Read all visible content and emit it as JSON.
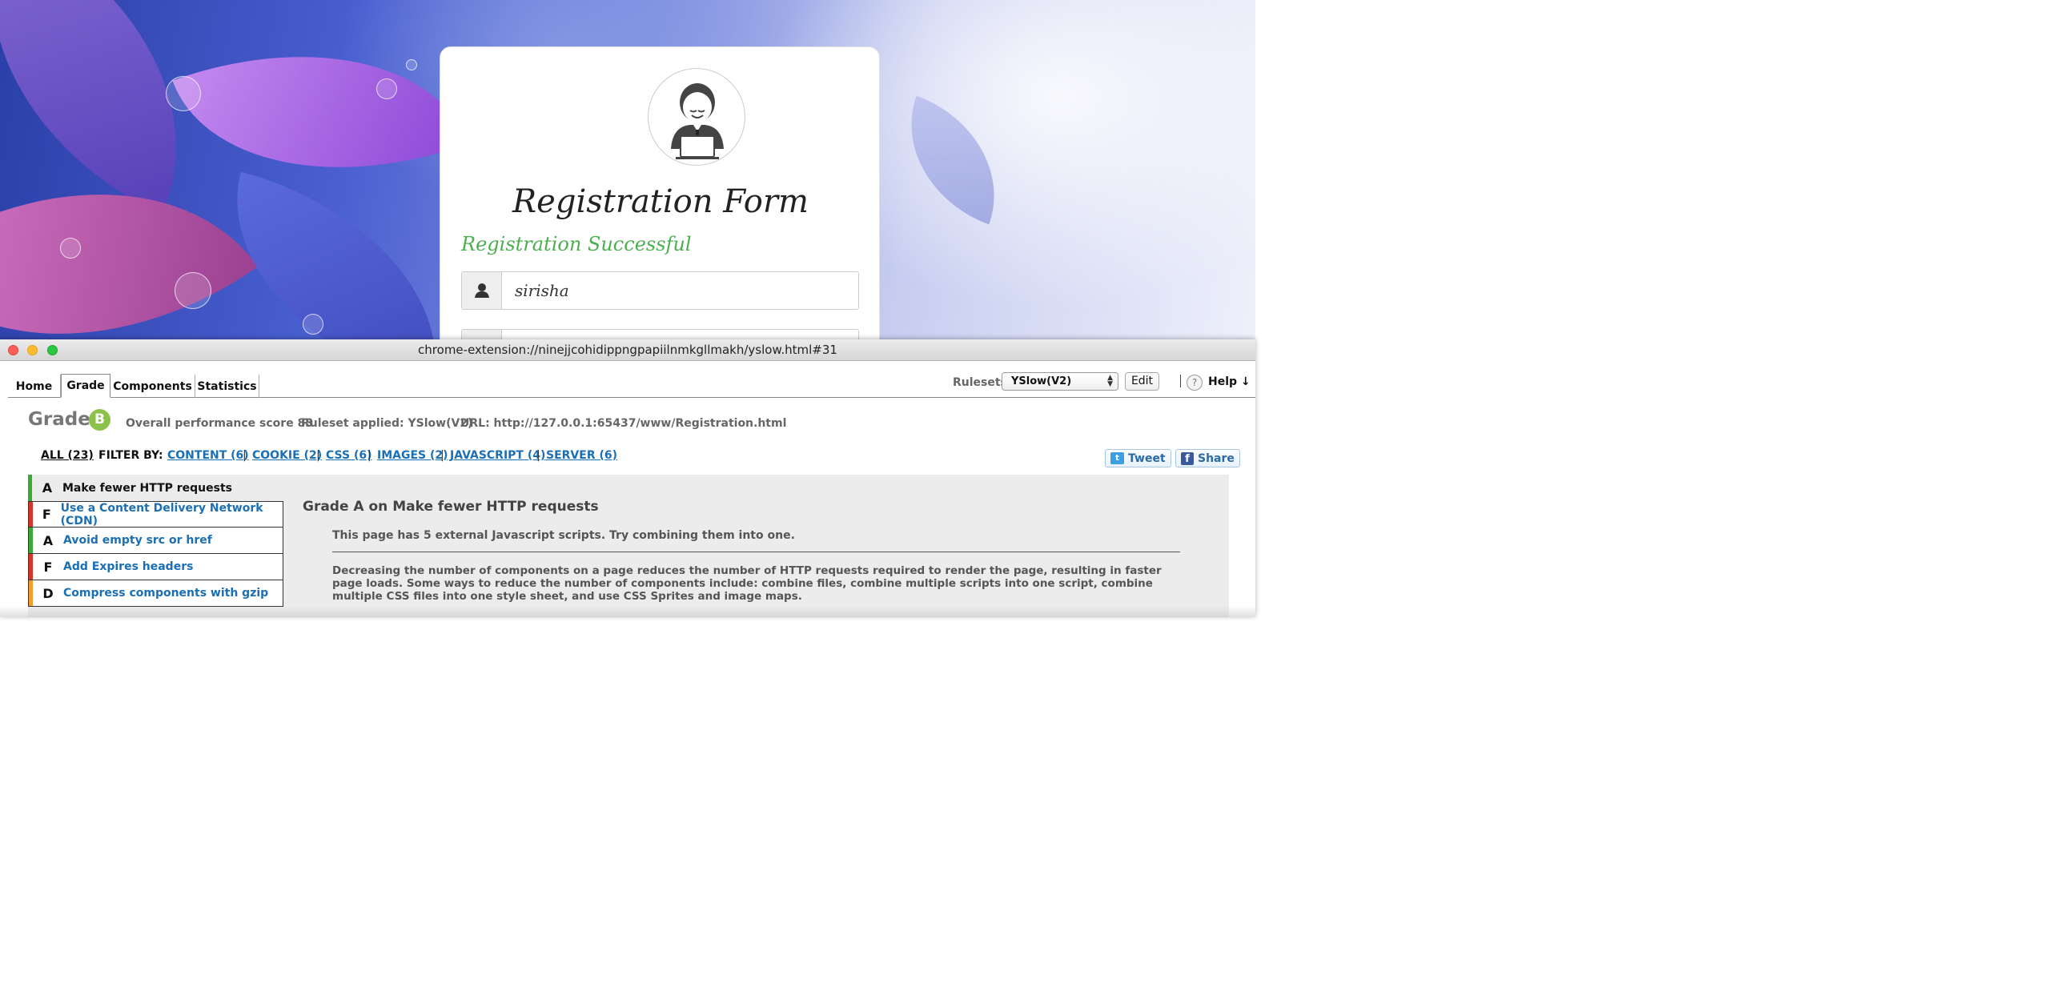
{
  "background_page": {
    "form_title": "Registration Form",
    "success_message": "Registration Successful",
    "username_value": "sirisha",
    "username_icon": "user-icon",
    "avatar_icon": "user-with-laptop-icon"
  },
  "window": {
    "url": "chrome-extension://ninejjcohidippngpapiilnmkgllmakh/yslow.html#31"
  },
  "nav": {
    "tabs": [
      "Home",
      "Grade",
      "Components",
      "Statistics"
    ],
    "active_tab": "Grade",
    "rulesets_label": "Rulesets",
    "ruleset_selected": "YSlow(V2)",
    "edit_label": "Edit",
    "help_icon": "?",
    "help_label": "Help ↓"
  },
  "grade": {
    "title": "Grade",
    "letter": "B",
    "overall_score": "Overall performance score 83",
    "ruleset_applied": "Ruleset applied: YSlow(V2)",
    "url": "URL: http://127.0.0.1:65437/www/Registration.html"
  },
  "filters": {
    "all": "ALL (23)",
    "filter_by": "FILTER BY:",
    "items": [
      "CONTENT (6)",
      "COOKIE (2)",
      "CSS (6)",
      "IMAGES (2)",
      "JAVASCRIPT (4)",
      "SERVER (6)"
    ],
    "separator": "|"
  },
  "social": {
    "tweet": "Tweet",
    "share": "Share"
  },
  "rules": [
    {
      "grade": "A",
      "name": "Make fewer HTTP requests",
      "color": "#3aa935",
      "selected": true
    },
    {
      "grade": "F",
      "name": "Use a Content Delivery Network (CDN)",
      "color": "#d9342b",
      "selected": false
    },
    {
      "grade": "A",
      "name": "Avoid empty src or href",
      "color": "#3aa935",
      "selected": false
    },
    {
      "grade": "F",
      "name": "Add Expires headers",
      "color": "#d9342b",
      "selected": false
    },
    {
      "grade": "D",
      "name": "Compress components with gzip",
      "color": "#f0a030",
      "selected": false
    }
  ],
  "detail": {
    "title": "Grade A on Make fewer HTTP requests",
    "message": "This page has 5 external Javascript scripts. Try combining them into one.",
    "description": "Decreasing the number of components on a page reduces the number of HTTP requests required to render the page, resulting in faster page loads. Some ways to reduce the number of components include: combine files, combine multiple scripts into one script, combine multiple CSS files into one style sheet, and use CSS Sprites and image maps."
  },
  "colors": {
    "grade_badge": "#8bc34a",
    "link": "#1b6fb5",
    "success_green": "#4caf50"
  }
}
